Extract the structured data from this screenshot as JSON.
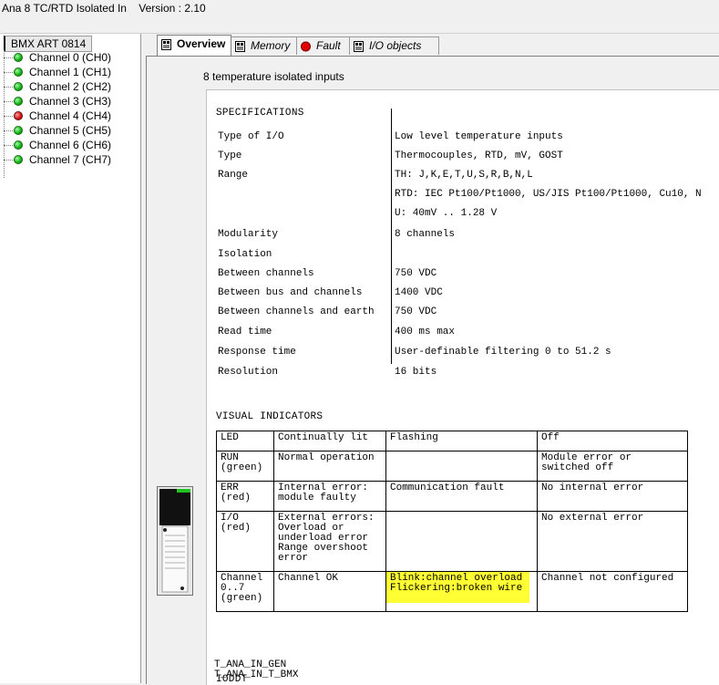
{
  "window": {
    "title": "Ana 8 TC/RTD Isolated In    Version : 2.10"
  },
  "tree": {
    "root": "BMX ART 0814",
    "channels": [
      {
        "label": "Channel 0 (CH0)",
        "status_color": "#10b010"
      },
      {
        "label": "Channel 1 (CH1)",
        "status_color": "#10b010"
      },
      {
        "label": "Channel 2 (CH2)",
        "status_color": "#10b010"
      },
      {
        "label": "Channel 3 (CH3)",
        "status_color": "#10b010"
      },
      {
        "label": "Channel 4 (CH4)",
        "status_color": "#d01010"
      },
      {
        "label": "Channel 5 (CH5)",
        "status_color": "#10b010"
      },
      {
        "label": "Channel 6 (CH6)",
        "status_color": "#10b010"
      },
      {
        "label": "Channel 7 (CH7)",
        "status_color": "#10b010"
      }
    ]
  },
  "tabs": [
    {
      "label": "Overview",
      "icon": "module-icon",
      "active": true
    },
    {
      "label": "Memory",
      "icon": "module-icon",
      "active": false
    },
    {
      "label": "Fault",
      "icon": "fault-icon",
      "active": false
    },
    {
      "label": "I/O objects",
      "icon": "module-icon",
      "active": false
    }
  ],
  "overview": {
    "subtitle": "8 temperature isolated inputs",
    "specifications": {
      "heading": "SPECIFICATIONS",
      "rows": [
        {
          "key": "Type of I/O",
          "value": "Low level temperature inputs"
        },
        {
          "key": "Type",
          "value": "Thermocouples, RTD, mV, GOST"
        },
        {
          "key": "Range",
          "value": "TH: J,K,E,T,U,S,R,B,N,L"
        },
        {
          "key": "",
          "value": "RTD: IEC Pt100/Pt1000, US/JIS Pt100/Pt1000, Cu10, N"
        },
        {
          "key": "",
          "value": "U: 40mV .. 1.28 V"
        },
        {
          "key": "Modularity",
          "value": "8 channels"
        },
        {
          "key": "Isolation",
          "value": ""
        },
        {
          "key": "Between channels",
          "value": "750 VDC"
        },
        {
          "key": "Between bus and channels",
          "value": "1400 VDC"
        },
        {
          "key": "Between channels and earth",
          "value": "750 VDC"
        },
        {
          "key": "Read time",
          "value": "400 ms max"
        },
        {
          "key": "Response time",
          "value": "User-definable filtering 0 to 51.2 s"
        },
        {
          "key": "Resolution",
          "value": "16 bits"
        }
      ]
    },
    "visual_indicators": {
      "heading": "VISUAL INDICATORS",
      "header": {
        "led": "LED",
        "lit": "Continually lit",
        "flash": "Flashing",
        "off": "Off"
      },
      "rows": [
        {
          "led": "RUN\n(green)",
          "lit": "Normal operation",
          "flash": "",
          "off": "Module error or\nswitched off"
        },
        {
          "led": "ERR\n(red)",
          "lit": "Internal error:\nmodule faulty",
          "flash": "Communication fault",
          "off": "No internal error"
        },
        {
          "led": "I/O\n(red)",
          "lit": "External errors:\nOverload or\nunderload error\nRange overshoot\nerror",
          "flash": "",
          "off": "No external error"
        },
        {
          "led": "Channel\n0..7\n(green)",
          "lit": "Channel OK",
          "flash": "Blink:channel overload\nFlickering:broken wire",
          "off": "Channel not configured"
        }
      ],
      "highlight_color": "#ffff33"
    },
    "ioddt": {
      "heading": "IODDT",
      "items": [
        "T_ANA_IN_GEN",
        "T_ANA_IN_T_BMX"
      ]
    }
  }
}
